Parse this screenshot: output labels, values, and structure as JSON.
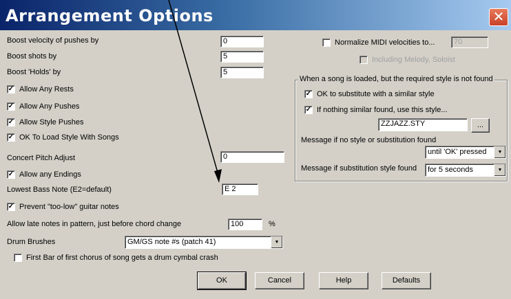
{
  "window": {
    "title": "Arrangement Options",
    "close_symbol": "✕"
  },
  "left": {
    "boost_pushes_label": "Boost velocity of pushes by",
    "boost_pushes_value": "0",
    "boost_shots_label": "Boost shots by",
    "boost_shots_value": "5",
    "boost_holds_label": "Boost 'Holds' by",
    "boost_holds_value": "5",
    "allow_rests_label": "Allow Any Rests",
    "allow_pushes_label": "Allow Any Pushes",
    "allow_style_pushes_label": "Allow Style Pushes",
    "ok_load_style_label": "OK To Load Style With Songs",
    "concert_pitch_label": "Concert Pitch Adjust",
    "concert_pitch_value": "0",
    "allow_endings_label": "Allow any Endings",
    "lowest_bass_label": "Lowest Bass Note (E2=default)",
    "lowest_bass_value": "E 2",
    "prevent_low_label": "Prevent \"too-low\" guitar notes",
    "late_notes_label": "Allow late notes in pattern, just before chord change",
    "late_notes_value": "100",
    "late_notes_unit": "%",
    "drum_brushes_label": "Drum Brushes",
    "drum_brushes_value": "GM/GS note #s (patch 41)",
    "cymbal_crash_label": "First Bar of first chorus of song gets a drum cymbal crash",
    "check_mark": "✓"
  },
  "right": {
    "normalize_label": "Normalize MIDI velocities to...",
    "normalize_value": "70",
    "include_melody_label": "Including Melody, Soloist",
    "group_title": "When a song is loaded, but the required style is not found",
    "ok_substitute_label": "OK to substitute with a similar style",
    "if_nothing_label": "If nothing similar found, use this style...",
    "style_file_value": "ZZJAZZ.STY",
    "browse_label": "...",
    "msg_no_style_label": "Message if no style or substitution found",
    "msg_no_style_value": "until 'OK' pressed",
    "msg_subst_label": "Message if substitution style  found",
    "msg_subst_value": "for 5 seconds"
  },
  "buttons": {
    "ok": "OK",
    "cancel": "Cancel",
    "help": "Help",
    "defaults": "Defaults"
  },
  "colors": {
    "dialog_bg": "#d4d0c8",
    "title_start": "#0a246a",
    "title_end": "#a6caf0",
    "close_bg": "#c9412a"
  }
}
